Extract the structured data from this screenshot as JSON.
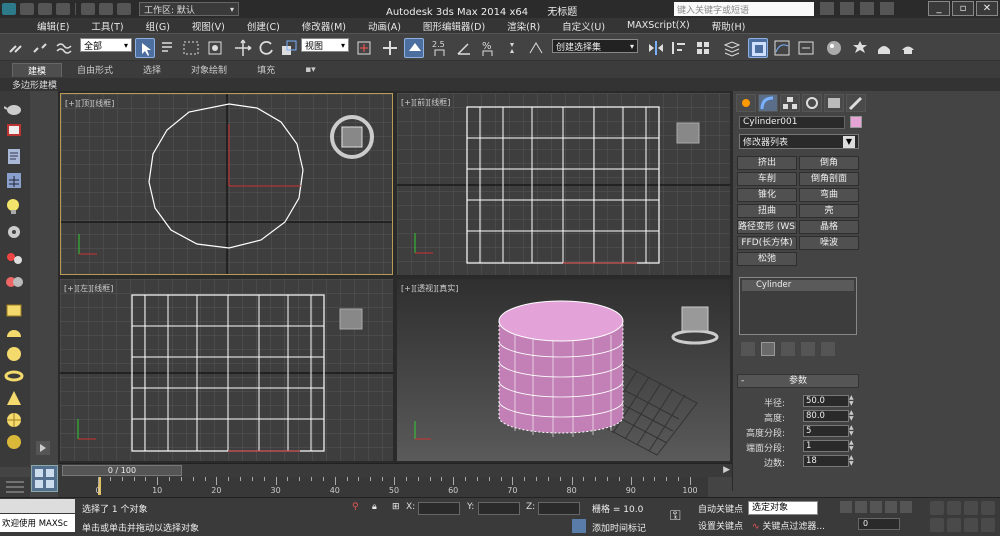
{
  "titlebar": {
    "workspace_label": "工作区: 默认",
    "app_title": "Autodesk 3ds Max  2014 x64",
    "doc_title": "无标题",
    "search_placeholder": "键入关键字或短语"
  },
  "menu": {
    "items": [
      "编辑(E)",
      "工具(T)",
      "组(G)",
      "视图(V)",
      "创建(C)",
      "修改器(M)",
      "动画(A)",
      "图形编辑器(D)",
      "渲染(R)",
      "自定义(U)",
      "MAXScript(X)",
      "帮助(H)"
    ]
  },
  "toolbar": {
    "filter_value": "全部",
    "refcoord_value": "视图",
    "selection_set": "创建选择集",
    "snap_label": "2.5",
    "percent_snap_label": "%"
  },
  "ribbon": {
    "tabs": [
      "建模",
      "自由形式",
      "选择",
      "对象绘制",
      "填充"
    ],
    "sub_label": "多边形建模"
  },
  "viewports": {
    "top": "[+][顶][线框]",
    "front": "[+][前][线框]",
    "left": "[+][左][线框]",
    "persp": "[+][透视][真实]"
  },
  "command_panel": {
    "object_name": "Cylinder001",
    "object_color": "#e5a3d6",
    "modifier_list": "修改器列表",
    "modifier_buttons": [
      "挤出",
      "倒角",
      "车削",
      "倒角剖面",
      "锥化",
      "弯曲",
      "扭曲",
      "壳",
      "路径变形 (WSM)",
      "晶格",
      "FFD(长方体)",
      "噪波",
      "松弛"
    ],
    "stack_item": "Cylinder",
    "params_title": "参数",
    "params": [
      {
        "label": "半径:",
        "value": "50.0"
      },
      {
        "label": "高度:",
        "value": "80.0"
      },
      {
        "label": "高度分段:",
        "value": "5"
      },
      {
        "label": "端面分段:",
        "value": "1"
      },
      {
        "label": "边数:",
        "value": "18"
      }
    ]
  },
  "timeline": {
    "position": "0 / 100",
    "current_frame_fraction": 0,
    "ticks": [
      "0",
      "10",
      "20",
      "30",
      "40",
      "50",
      "60",
      "70",
      "80",
      "90",
      "100"
    ]
  },
  "status": {
    "welcome": "欢迎使用 MAXSc",
    "selected": "选择了 1 个对象",
    "prompt": "单击或单击并拖动以选择对象",
    "x_label": "X:",
    "y_label": "Y:",
    "z_label": "Z:",
    "grid": "栅格 = 10.0",
    "add_time_tag": "添加时间标记",
    "auto_key": "自动关键点",
    "set_key": "设置关键点",
    "selected_filter": "选定对象",
    "key_filters": "关键点过滤器...",
    "frame": "0"
  }
}
